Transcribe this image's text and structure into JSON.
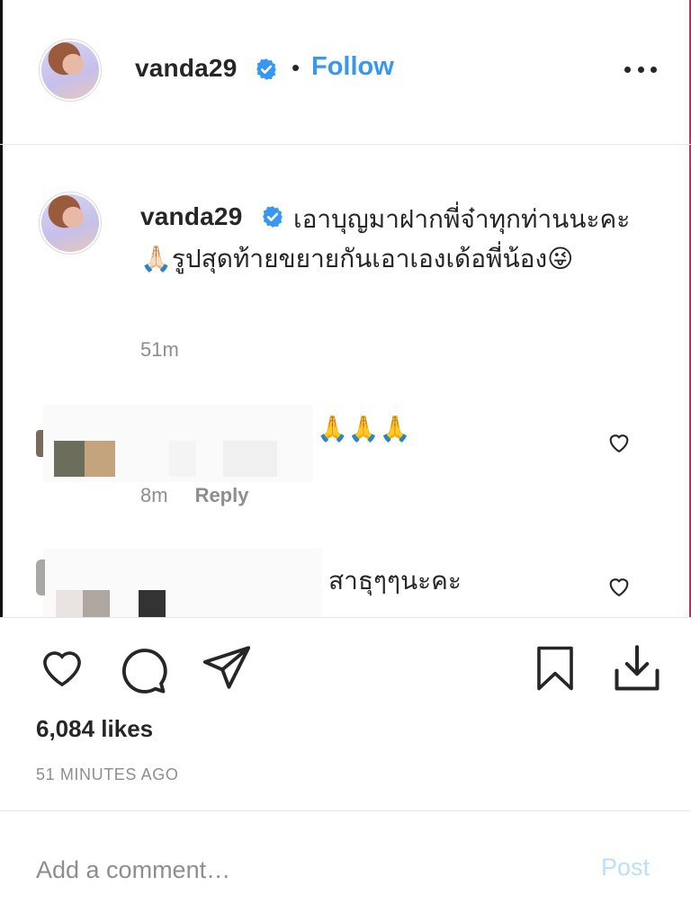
{
  "header": {
    "username": "vanda29",
    "separator": "•",
    "follow_label": "Follow"
  },
  "caption": {
    "username": "vanda29",
    "text": "เอาบุญมาฝากพี่จ๋าทุกท่านนะคะ 🙏🏻รูปสุดท้ายขยายกันเอาเองเด้อพี่น้อง😜",
    "timestamp": "51m"
  },
  "comments": [
    {
      "text": "🙏🙏🙏",
      "time": "8m",
      "reply_label": "Reply"
    },
    {
      "text": "สาธุๆๆนะคะ"
    }
  ],
  "post": {
    "likes": "6,084 likes",
    "time_ago": "51 MINUTES AGO"
  },
  "add_comment": {
    "placeholder": "Add a comment…",
    "post_label": "Post"
  },
  "colors": {
    "link_blue": "#3897f0",
    "verified_blue": "#3897f0",
    "post_disabled": "#b9dffc",
    "text": "#262626",
    "muted": "#8e8e8e"
  },
  "icons": [
    "verified-badge-icon",
    "more-options-icon",
    "heart-icon",
    "comment-icon",
    "share-icon",
    "bookmark-icon",
    "download-icon"
  ]
}
